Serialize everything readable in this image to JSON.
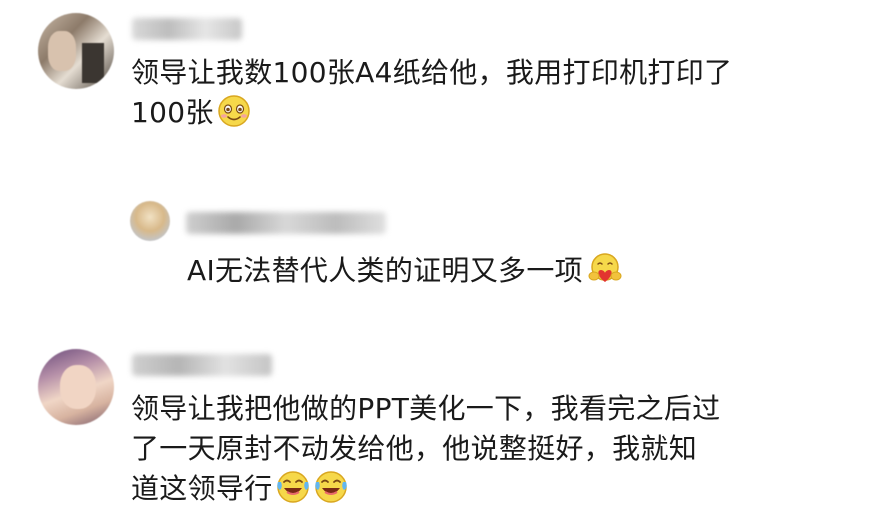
{
  "comments": [
    {
      "lines": [
        "领导让我数100张A4纸给他，我用打印机打印了",
        "100张"
      ],
      "emojis": [
        "smile-emoji"
      ]
    },
    {
      "lines": [
        "AI无法替代人类的证明又多一项"
      ],
      "emojis": [
        "hug-emoji"
      ]
    },
    {
      "lines": [
        "领导让我把他做的PPT美化一下，我看完之后过",
        "了一天原封不动发给他，他说整挺好，我就知",
        "道这领导行"
      ],
      "emojis": [
        "laugh-cry-emoji",
        "laugh-cry-emoji"
      ]
    }
  ]
}
